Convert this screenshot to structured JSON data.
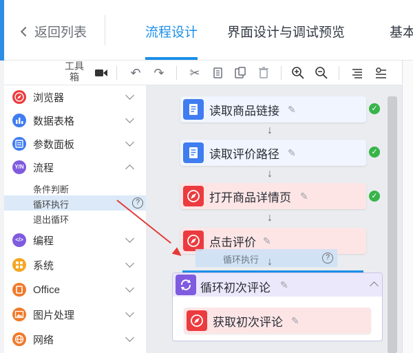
{
  "header": {
    "back_label": "返回列表",
    "tabs": [
      {
        "label": "流程设计"
      },
      {
        "label": "界面设计与调试预览"
      },
      {
        "label": "基本"
      }
    ]
  },
  "toolbar": {
    "title_line1": "工具",
    "title_line2": "箱",
    "icons": [
      "video-icon",
      "undo-icon",
      "redo-icon",
      "cut-icon",
      "copy-icon",
      "paste-icon",
      "delete-icon",
      "zoom-in-icon",
      "zoom-out-icon",
      "align-icon",
      "settings-icon"
    ]
  },
  "sidebar": {
    "items": [
      {
        "label": "浏览器",
        "icon": "compass-icon",
        "color": "#ec3b3f",
        "expanded": false
      },
      {
        "label": "数据表格",
        "icon": "bar-chart-icon",
        "color": "#3f7df0",
        "expanded": false
      },
      {
        "label": "参数面板",
        "icon": "panel-icon",
        "color": "#3f7df0",
        "expanded": false
      },
      {
        "label": "流程",
        "icon": "flow-icon",
        "color": "#7f5bdf",
        "icon_text": "Y/N",
        "expanded": true
      },
      {
        "label": "编程",
        "icon": "code-icon",
        "color": "#7f5bdf",
        "icon_text": "</>",
        "expanded": false
      },
      {
        "label": "系统",
        "icon": "system-icon",
        "color": "#f5a623",
        "expanded": false
      },
      {
        "label": "Office",
        "icon": "office-icon",
        "color": "#f07a2a",
        "expanded": false
      },
      {
        "label": "图片处理",
        "icon": "image-icon",
        "color": "#f07a2a",
        "expanded": false
      },
      {
        "label": "网络",
        "icon": "network-icon",
        "color": "#f07a2a",
        "expanded": false
      }
    ],
    "flow_children": [
      {
        "label": "条件判断",
        "selected": false
      },
      {
        "label": "循环执行",
        "selected": true
      },
      {
        "label": "退出循环",
        "selected": false
      }
    ]
  },
  "canvas": {
    "steps": [
      {
        "label": "读取商品链接",
        "icon": "document-icon",
        "type": "blue",
        "done": true
      },
      {
        "label": "读取评价路径",
        "icon": "document-icon",
        "type": "blue",
        "done": true
      },
      {
        "label": "打开商品详情页",
        "icon": "compass-icon",
        "type": "red",
        "done": true
      },
      {
        "label": "点击评价",
        "icon": "compass-icon",
        "type": "red",
        "done": false
      }
    ],
    "drag_ghost_label": "循环执行",
    "loop": {
      "label": "循环初次评论",
      "child_label": "获取初次评论"
    }
  },
  "colors": {
    "accent": "#1a8fe8",
    "success": "#38b449",
    "annotation_arrow": "#e53935"
  }
}
